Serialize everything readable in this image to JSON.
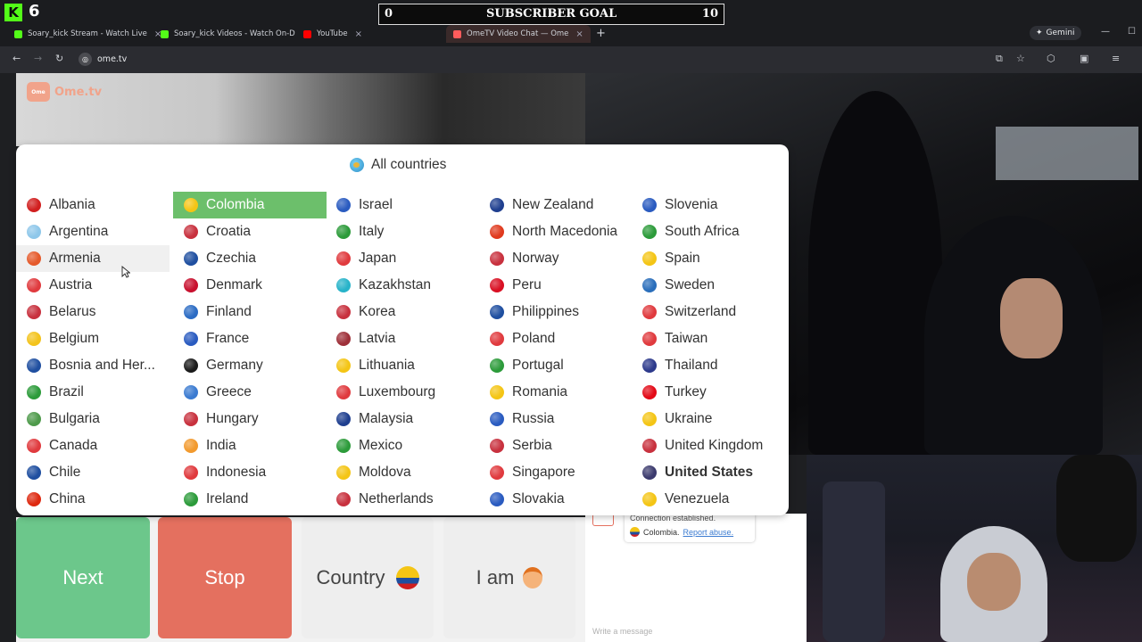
{
  "stream_overlay": {
    "kick_count": "6",
    "goal_title": "SUBSCRIBER GOAL",
    "goal_current": "0",
    "goal_target": "10"
  },
  "tabs": [
    {
      "label": "Soary_kick Stream - Watch Live",
      "color": "#53fc18"
    },
    {
      "label": "Soary_kick Videos - Watch On-D",
      "color": "#53fc18"
    },
    {
      "label": "YouTube",
      "color": "#ff0000"
    },
    {
      "label": "OmeTV Video Chat — Ome",
      "color": "#ff5c5c"
    }
  ],
  "browser": {
    "url": "ome.tv",
    "gemini_label": "Gemini"
  },
  "logo": {
    "text": "Ome.tv"
  },
  "country_panel": {
    "title": "All countries",
    "selected": "Colombia",
    "hovered": "Armenia",
    "columns": [
      [
        {
          "name": "Albania",
          "color": "#d11f1f"
        },
        {
          "name": "Argentina",
          "color": "#8ec7ea"
        },
        {
          "name": "Armenia",
          "color": "#e55a2b"
        },
        {
          "name": "Austria",
          "color": "#e03a3e"
        },
        {
          "name": "Belarus",
          "color": "#c8313e"
        },
        {
          "name": "Belgium",
          "color": "#f3c31c"
        },
        {
          "name": "Bosnia and Her...",
          "color": "#1f4fa0"
        },
        {
          "name": "Brazil",
          "color": "#2c9b3a"
        },
        {
          "name": "Bulgaria",
          "color": "#4e9a4b"
        },
        {
          "name": "Canada",
          "color": "#e03a3e"
        },
        {
          "name": "Chile",
          "color": "#1f4fa0"
        },
        {
          "name": "China",
          "color": "#de2910"
        }
      ],
      [
        {
          "name": "Colombia",
          "color": "#f4c515"
        },
        {
          "name": "Croatia",
          "color": "#c8313e"
        },
        {
          "name": "Czechia",
          "color": "#1f4fa0"
        },
        {
          "name": "Denmark",
          "color": "#c8102e"
        },
        {
          "name": "Finland",
          "color": "#2c6cc4"
        },
        {
          "name": "France",
          "color": "#2a5bc0"
        },
        {
          "name": "Germany",
          "color": "#1b1b1b"
        },
        {
          "name": "Greece",
          "color": "#3b7bd1"
        },
        {
          "name": "Hungary",
          "color": "#c8313e"
        },
        {
          "name": "India",
          "color": "#f29a2e"
        },
        {
          "name": "Indonesia",
          "color": "#e03a3e"
        },
        {
          "name": "Ireland",
          "color": "#2c9b3a"
        }
      ],
      [
        {
          "name": "Israel",
          "color": "#2a5bc0"
        },
        {
          "name": "Italy",
          "color": "#2c9b3a"
        },
        {
          "name": "Japan",
          "color": "#e03a3e"
        },
        {
          "name": "Kazakhstan",
          "color": "#27b3c9"
        },
        {
          "name": "Korea",
          "color": "#c8313e"
        },
        {
          "name": "Latvia",
          "color": "#9e3039"
        },
        {
          "name": "Lithuania",
          "color": "#f4c515"
        },
        {
          "name": "Luxembourg",
          "color": "#e03a3e"
        },
        {
          "name": "Malaysia",
          "color": "#1f3f8f"
        },
        {
          "name": "Mexico",
          "color": "#2c9b3a"
        },
        {
          "name": "Moldova",
          "color": "#f4c515"
        },
        {
          "name": "Netherlands",
          "color": "#c8313e"
        }
      ],
      [
        {
          "name": "New Zealand",
          "color": "#1f3f8f"
        },
        {
          "name": "North Macedonia",
          "color": "#e03a1e"
        },
        {
          "name": "Norway",
          "color": "#c8313e"
        },
        {
          "name": "Peru",
          "color": "#d91023"
        },
        {
          "name": "Philippines",
          "color": "#1f4fa0"
        },
        {
          "name": "Poland",
          "color": "#e03a3e"
        },
        {
          "name": "Portugal",
          "color": "#2c9b3a"
        },
        {
          "name": "Romania",
          "color": "#f4c515"
        },
        {
          "name": "Russia",
          "color": "#2a5bc0"
        },
        {
          "name": "Serbia",
          "color": "#c8313e"
        },
        {
          "name": "Singapore",
          "color": "#e03a3e"
        },
        {
          "name": "Slovakia",
          "color": "#2a5bc0"
        }
      ],
      [
        {
          "name": "Slovenia",
          "color": "#2a5bc0"
        },
        {
          "name": "South Africa",
          "color": "#2c9b3a"
        },
        {
          "name": "Spain",
          "color": "#f4c515"
        },
        {
          "name": "Sweden",
          "color": "#2a6ebb"
        },
        {
          "name": "Switzerland",
          "color": "#e03a3e"
        },
        {
          "name": "Taiwan",
          "color": "#e03a3e"
        },
        {
          "name": "Thailand",
          "color": "#2d3a8c"
        },
        {
          "name": "Turkey",
          "color": "#e30a17"
        },
        {
          "name": "Ukraine",
          "color": "#f4c515"
        },
        {
          "name": "United Kingdom",
          "color": "#c8313e"
        },
        {
          "name": "United States",
          "color": "#3c3b6e"
        },
        {
          "name": "Venezuela",
          "color": "#f4c515"
        }
      ]
    ]
  },
  "buttons": {
    "next": "Next",
    "stop": "Stop",
    "country": "Country",
    "country_flag": "#f4c515",
    "iam": "I am"
  },
  "chat": {
    "status": "Connection established.",
    "country": "Colombia.",
    "report": "Report abuse.",
    "placeholder": "Write a message"
  }
}
